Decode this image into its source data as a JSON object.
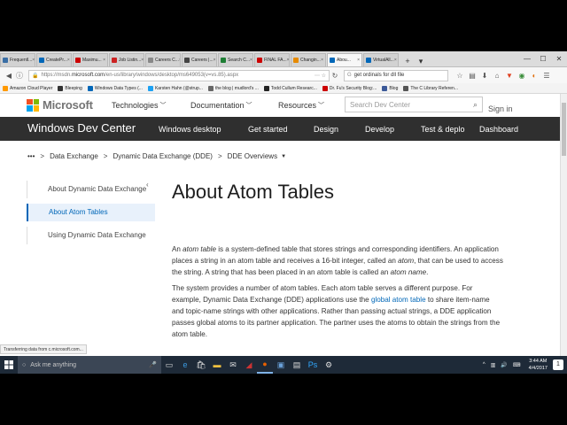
{
  "browser": {
    "tabs": [
      {
        "label": "Frequentl...",
        "color": "#3a6ea5",
        "active": false
      },
      {
        "label": "CreatePr...",
        "color": "#0067b8",
        "active": false
      },
      {
        "label": "Maximu...",
        "color": "#cc0000",
        "active": false
      },
      {
        "label": "Job Listin...",
        "color": "#cc2222",
        "active": false
      },
      {
        "label": "Careers C...",
        "color": "#888888",
        "active": false
      },
      {
        "label": "Careers |...",
        "color": "#444444",
        "active": false
      },
      {
        "label": "Search C...",
        "color": "#1e7e34",
        "active": false
      },
      {
        "label": "FINAL FA...",
        "color": "#cc0000",
        "active": false
      },
      {
        "label": "Changin...",
        "color": "#e68a00",
        "active": false
      },
      {
        "label": "Abou...",
        "color": "#0067b8",
        "active": true
      },
      {
        "label": "VirtualAll...",
        "color": "#0067b8",
        "active": false
      }
    ],
    "new_tab": "+",
    "tab_menu": "▾",
    "window_controls": {
      "minimize": "—",
      "maximize": "☐",
      "close": "✕"
    },
    "url_prefix": "https://msdn.",
    "url_host": "microsoft.com",
    "url_rest": "/en-us/library/windows/desktop/ms649053(v=vs.85).aspx",
    "url_tools": "⋯  ☆",
    "search_value": "get ordinals for dll file",
    "bookmarks": [
      {
        "label": "Amazon Cloud Player",
        "color": "#ff9900"
      },
      {
        "label": "Bleeping",
        "color": "#333333"
      },
      {
        "label": "Windows Data Types (...",
        "color": "#0067b8"
      },
      {
        "label": "Karsten Hahn (@strup...",
        "color": "#1da1f2"
      },
      {
        "label": "the blog | mudlord's ...",
        "color": "#666666"
      },
      {
        "label": "Todd Cullum Researc...",
        "color": "#222222"
      },
      {
        "label": "Dr. Fu's Security Blog:...",
        "color": "#cc0000"
      },
      {
        "label": "Blog",
        "color": "#3b5998"
      },
      {
        "label": "The C Library Referen...",
        "color": "#555555"
      }
    ],
    "status_text": "Transferring data from c.microsoft.com..."
  },
  "site": {
    "brand": "Microsoft",
    "nav": [
      "Technologies",
      "Documentation",
      "Resources"
    ],
    "search_placeholder": "Search Dev Center",
    "signin": "Sign in",
    "dev_center_title": "Windows Dev Center",
    "dev_nav": [
      "Windows desktop",
      "Get started",
      "Design",
      "Develop",
      "Test & deplo",
      "Dashboard"
    ]
  },
  "breadcrumb": {
    "more": "•••",
    "items": [
      "Data Exchange",
      "Dynamic Data Exchange (DDE)",
      "DDE Overviews"
    ],
    "separator": ">"
  },
  "sidebar": {
    "items": [
      {
        "label": "About Dynamic Data Exchange",
        "active": false
      },
      {
        "label": "About Atom Tables",
        "active": true
      },
      {
        "label": "Using Dynamic Data Exchange",
        "active": false
      }
    ]
  },
  "article": {
    "title": "About Atom Tables",
    "p1_a": "An ",
    "p1_em1": "atom table",
    "p1_b": " is a system-defined table that stores strings and corresponding identifiers. An application places a string in an atom table and receives a 16-bit integer, called an ",
    "p1_em2": "atom",
    "p1_c": ", that can be used to access the string. A string that has been placed in an atom table is called an ",
    "p1_em3": "atom name",
    "p1_d": ".",
    "p2_a": "The system provides a number of atom tables. Each atom table serves a different purpose. For example, Dynamic Data Exchange (DDE) applications use the ",
    "p2_link": "global atom table",
    "p2_b": " to share item-name and topic-name strings with other applications. Rather than passing actual strings, a DDE application passes global atoms to its partner application. The partner uses the atoms to obtain the strings from the atom table."
  },
  "taskbar": {
    "search_placeholder": "Ask me anything",
    "time": "3:44 AM",
    "date": "4/4/2017",
    "notification_count": "1"
  }
}
